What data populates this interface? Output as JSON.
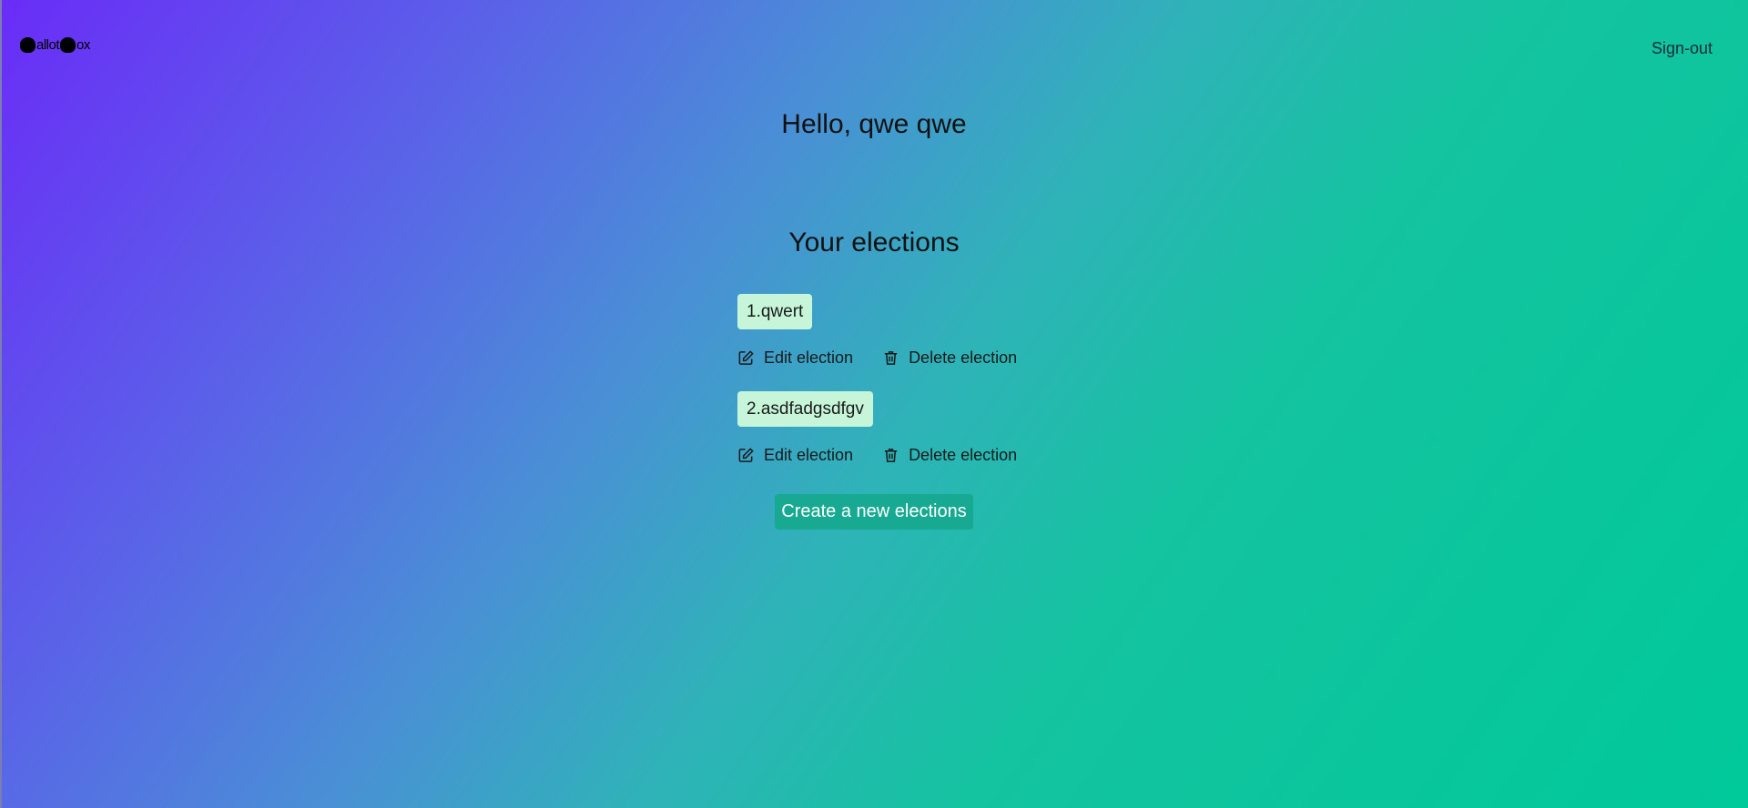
{
  "brand": {
    "logo_text_1": "B",
    "logo_text_2": "allot",
    "logo_text_3": "B",
    "logo_text_4": "ox"
  },
  "header": {
    "signout_label": "Sign-out"
  },
  "main": {
    "greeting": "Hello, qwe qwe",
    "section_title": "Your elections",
    "elections": [
      {
        "name": "1.qwert",
        "edit_label": "Edit election",
        "delete_label": "Delete election"
      },
      {
        "name": "2.asdfadgsdfgv",
        "edit_label": "Edit election",
        "delete_label": "Delete election"
      }
    ],
    "create_label": "Create a new elections"
  },
  "colors": {
    "gradient_start": "#6a2cf7",
    "gradient_end": "#00c99a",
    "election_chip": "#c6f5d9",
    "create_button": "#17a991"
  },
  "icons": {
    "edit": "pencil-square-icon",
    "delete": "trash-icon"
  }
}
